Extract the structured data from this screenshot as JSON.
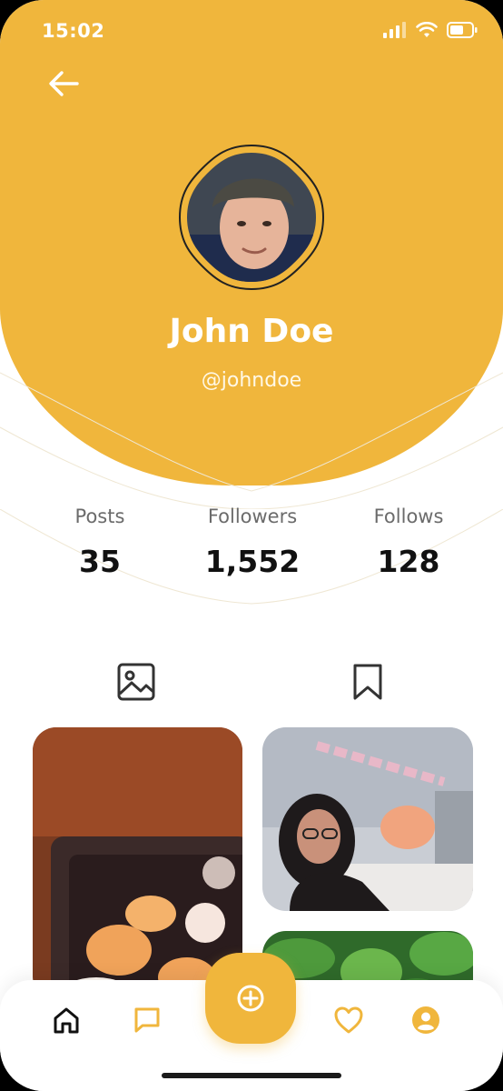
{
  "status_bar": {
    "time": "15:02"
  },
  "profile": {
    "name": "John Doe",
    "handle": "@johndoe"
  },
  "stats": [
    {
      "label": "Posts",
      "value": "35"
    },
    {
      "label": "Followers",
      "value": "1,552"
    },
    {
      "label": "Follows",
      "value": "128"
    }
  ],
  "tabs": [
    {
      "icon": "image-icon"
    },
    {
      "icon": "bookmark-icon"
    }
  ],
  "bottom_nav": [
    {
      "icon": "home-icon"
    },
    {
      "icon": "chat-icon"
    },
    {
      "icon": "add-circle-icon"
    },
    {
      "icon": "heart-icon"
    },
    {
      "icon": "user-icon"
    }
  ],
  "colors": {
    "accent": "#f0b63c",
    "text_dark": "#111111",
    "text_muted": "#6b6b6b"
  }
}
